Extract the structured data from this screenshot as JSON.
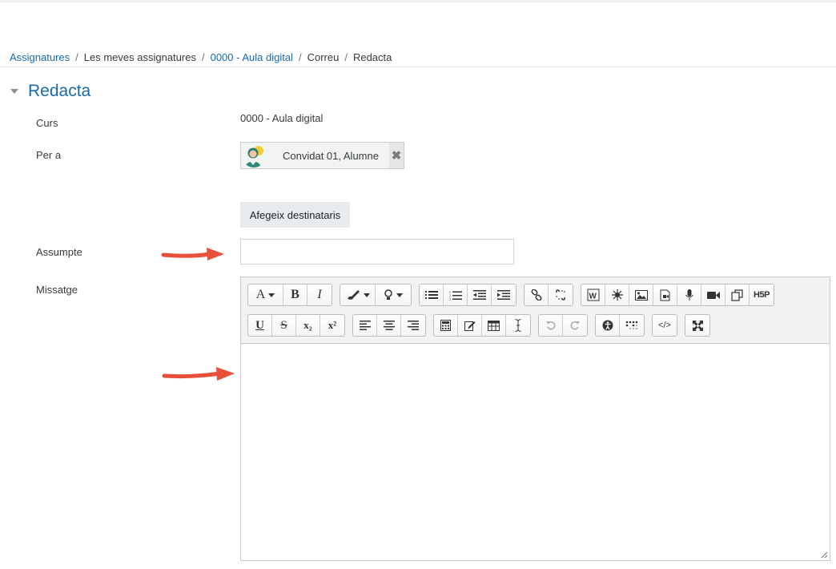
{
  "breadcrumb": {
    "items": [
      {
        "label": "Assignatures",
        "link": true
      },
      {
        "label": "Les meves assignatures",
        "link": false
      },
      {
        "label": "0000 - Aula digital",
        "link": true
      },
      {
        "label": "Correu",
        "link": false
      },
      {
        "label": "Redacta",
        "link": false
      }
    ],
    "separator": "/"
  },
  "section": {
    "title": "Redacta"
  },
  "form": {
    "course_label": "Curs",
    "course_value": "0000 - Aula digital",
    "to_label": "Per a",
    "recipient_name": "Convidat 01, Alumne",
    "remove_glyph": "✖",
    "add_recipients_label": "Afegeix destinataris",
    "subject_label": "Assumpte",
    "subject_value": "",
    "message_label": "Missatge"
  },
  "editor": {
    "row1": [
      [
        "font-icon",
        "bold-icon",
        "italic-icon"
      ],
      [
        "text-color-icon",
        "highlight-icon"
      ],
      [
        "unordered-list-icon",
        "ordered-list-icon",
        "outdent-icon",
        "indent-icon"
      ],
      [
        "link-icon",
        "unlink-icon"
      ],
      [
        "word-paste-icon",
        "special-char-icon",
        "image-icon",
        "media-icon",
        "record-audio-icon",
        "record-video-icon",
        "manage-files-icon",
        "h5p-icon"
      ]
    ],
    "row2": [
      [
        "underline-icon",
        "strikethrough-icon",
        "subscript-icon",
        "superscript-icon"
      ],
      [
        "align-left-icon",
        "align-center-icon",
        "align-right-icon"
      ],
      [
        "calculator-icon",
        "edit-equation-icon",
        "table-icon",
        "text-cursor-icon"
      ],
      [
        "undo-icon",
        "redo-icon"
      ],
      [
        "accessibility-checker-icon",
        "screenreader-helper-icon"
      ],
      [
        "html-source-icon"
      ],
      [
        "fullscreen-icon"
      ]
    ],
    "labels": {
      "bold": "B",
      "italic": "I",
      "underline": "U",
      "strike": "S",
      "sub": "x₂",
      "sup": "x²",
      "h5p": "H5P",
      "word": "W",
      "source": "</>"
    },
    "content": ""
  },
  "colors": {
    "link": "#1969ab",
    "arrow": "#e8503a",
    "toolbar_bg": "#f2f2f2",
    "button_bg": "#e9ecef"
  }
}
